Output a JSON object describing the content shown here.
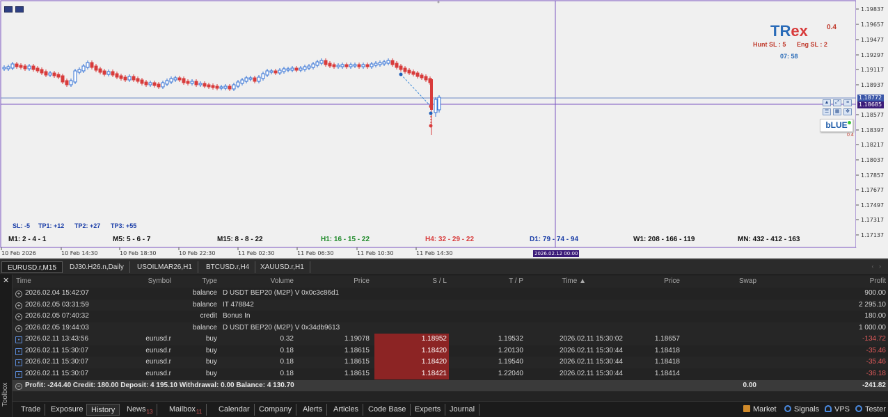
{
  "chart": {
    "price_axis": [
      "1.19837",
      "1.19657",
      "1.19477",
      "1.19297",
      "1.19117",
      "1.18937",
      "1.18577",
      "1.18397",
      "1.18217",
      "1.18037",
      "1.17857",
      "1.17677",
      "1.17497",
      "1.17317",
      "1.17137"
    ],
    "time_axis": [
      "10 Feb 2026",
      "10 Feb 14:30",
      "10 Feb 18:30",
      "10 Feb 22:30",
      "11 Feb 02:30",
      "11 Feb 06:30",
      "11 Feb 10:30",
      "11 Feb 14:30"
    ],
    "price_tag_upper": "1.18772",
    "price_tag_lower": "1.18685",
    "crosshair_date": "2026.02.12 00:00",
    "trex_title_a": "TR",
    "trex_title_b": "ex",
    "trex_value": "0.4",
    "hunt_sl": "Hunt SL : 5",
    "eng_sl": "Eng SL : 2",
    "timer": "07: 58",
    "blue_label": "bLUE",
    "blue_sub": "0.4",
    "levels": {
      "sl": "SL: -5",
      "tp1": "TP1: +12",
      "tp2": "TP2: +27",
      "tp3": "TP3: +55"
    },
    "timeframes": [
      {
        "label": "M1: 2 - 4 - 1",
        "color": "#111111"
      },
      {
        "label": "M5: 5 - 6 - 7",
        "color": "#111111"
      },
      {
        "label": "M15: 8 - 8 - 22",
        "color": "#111111"
      },
      {
        "label": "H1: 16 - 15 - 22",
        "color": "#1f8a2a"
      },
      {
        "label": "H4: 32 - 29 - 22",
        "color": "#d83b3b"
      },
      {
        "label": "D1: 79 - 74 - 94",
        "color": "#1c3fa8"
      },
      {
        "label": "W1: 208 - 166 - 119",
        "color": "#111111"
      },
      {
        "label": "MN: 432 - 412 - 163",
        "color": "#111111"
      }
    ]
  },
  "symbol_tabs": [
    "EURUSD.r,M15",
    "DJ30.H26.n,Daily",
    "USOILMAR26,H1",
    "BTCUSD.r,H4",
    "XAUUSD.r,H1"
  ],
  "table": {
    "headers": {
      "time": "Time",
      "symbol": "Symbol",
      "type": "Type",
      "volume": "Volume",
      "price": "Price",
      "sl": "S / L",
      "tp": "T / P",
      "time2": "Time",
      "price2": "Price",
      "swap": "Swap",
      "profit": "Profit"
    },
    "balance_rows": [
      {
        "time": "2026.02.04 15:42:07",
        "type": "balance",
        "comment": "D USDT BEP20 (M2P) V 0x0c3c86d1",
        "profit": "900.00"
      },
      {
        "time": "2026.02.05 03:31:59",
        "type": "balance",
        "comment": "IT 478842",
        "profit": "2 295.10"
      },
      {
        "time": "2026.02.05 07:40:32",
        "type": "credit",
        "comment": "Bonus In",
        "profit": "180.00"
      },
      {
        "time": "2026.02.05 19:44:03",
        "type": "balance",
        "comment": "D USDT BEP20 (M2P) V 0x34db9613",
        "profit": "1 000.00"
      }
    ],
    "trade_rows": [
      {
        "time": "2026.02.11 13:43:56",
        "symbol": "eurusd.r",
        "type": "buy",
        "volume": "0.32",
        "price": "1.19078",
        "sl": "1.18952",
        "tp": "1.19532",
        "time2": "2026.02.11 15:30:02",
        "price2": "1.18657",
        "profit": "-134.72"
      },
      {
        "time": "2026.02.11 15:30:07",
        "symbol": "eurusd.r",
        "type": "buy",
        "volume": "0.18",
        "price": "1.18615",
        "sl": "1.18420",
        "tp": "1.20130",
        "time2": "2026.02.11 15:30:44",
        "price2": "1.18418",
        "profit": "-35.46"
      },
      {
        "time": "2026.02.11 15:30:07",
        "symbol": "eurusd.r",
        "type": "buy",
        "volume": "0.18",
        "price": "1.18615",
        "sl": "1.18420",
        "tp": "1.19540",
        "time2": "2026.02.11 15:30:44",
        "price2": "1.18418",
        "profit": "-35.46"
      },
      {
        "time": "2026.02.11 15:30:07",
        "symbol": "eurusd.r",
        "type": "buy",
        "volume": "0.18",
        "price": "1.18615",
        "sl": "1.18421",
        "tp": "1.22040",
        "time2": "2026.02.11 15:30:44",
        "price2": "1.18414",
        "profit": "-36.18"
      }
    ],
    "summary": {
      "text": "Profit: -244.40  Credit: 180.00  Deposit: 4 195.10  Withdrawal: 0.00  Balance: 4 130.70",
      "swap": "0.00",
      "profit": "-241.82"
    }
  },
  "toolbox_label": "Toolbox",
  "bottom_tabs": [
    {
      "label": "Trade"
    },
    {
      "label": "Exposure"
    },
    {
      "label": "History",
      "active": true
    },
    {
      "label": "News",
      "badge": "13"
    },
    {
      "label": "Mailbox",
      "badge": "11"
    },
    {
      "label": "Calendar"
    },
    {
      "label": "Company"
    },
    {
      "label": "Alerts"
    },
    {
      "label": "Articles"
    },
    {
      "label": "Code Base"
    },
    {
      "label": "Experts"
    },
    {
      "label": "Journal"
    }
  ],
  "right_tools": {
    "market": "Market",
    "signals": "Signals",
    "vps": "VPS",
    "tester": "Tester"
  },
  "colors": {
    "bull": "#2f6fd6",
    "bear": "#d83b3b",
    "accent": "#6a3fb5"
  }
}
